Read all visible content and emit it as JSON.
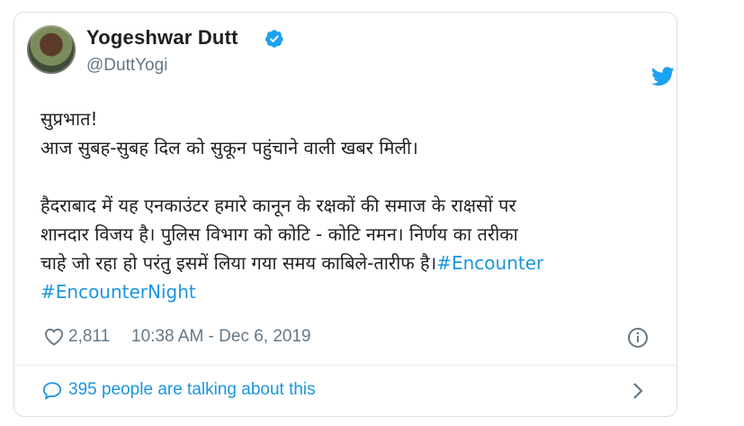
{
  "tweet": {
    "author": {
      "name": "Yogeshwar Dutt",
      "handle": "@DuttYogi",
      "verified": true
    },
    "body": {
      "line1": "सुप्रभात!",
      "line2": "आज सुबह-सुबह दिल को सुकून पहुंचाने वाली खबर मिली।",
      "line3": "हैदराबाद में यह एनकाउंटर हमारे कानून के रक्षकों की समाज के राक्षसों पर",
      "line4": "शानदार विजय है। पुलिस विभाग को कोटि - कोटि नमन। निर्णय का तरीका",
      "line5_text": "चाहे जो रहा हो परंतु इसमें लिया गया समय काबिले-तारीफ है।",
      "hashtag1": "#Encounter",
      "hashtag2": "#EncounterNight"
    },
    "likes": "2,811",
    "timestamp": "10:38 AM - Dec 6, 2019",
    "talking": "395 people are talking about this"
  },
  "icons": {
    "verified": "verified-badge-icon",
    "bird": "twitter-bird-icon",
    "heart": "heart-icon",
    "info": "info-icon",
    "bubble": "comment-bubble-icon",
    "chevron": "chevron-right-icon"
  },
  "colors": {
    "link": "#1b95e0",
    "muted": "#657786",
    "text": "#1c2022",
    "border": "#d9dfe3"
  }
}
